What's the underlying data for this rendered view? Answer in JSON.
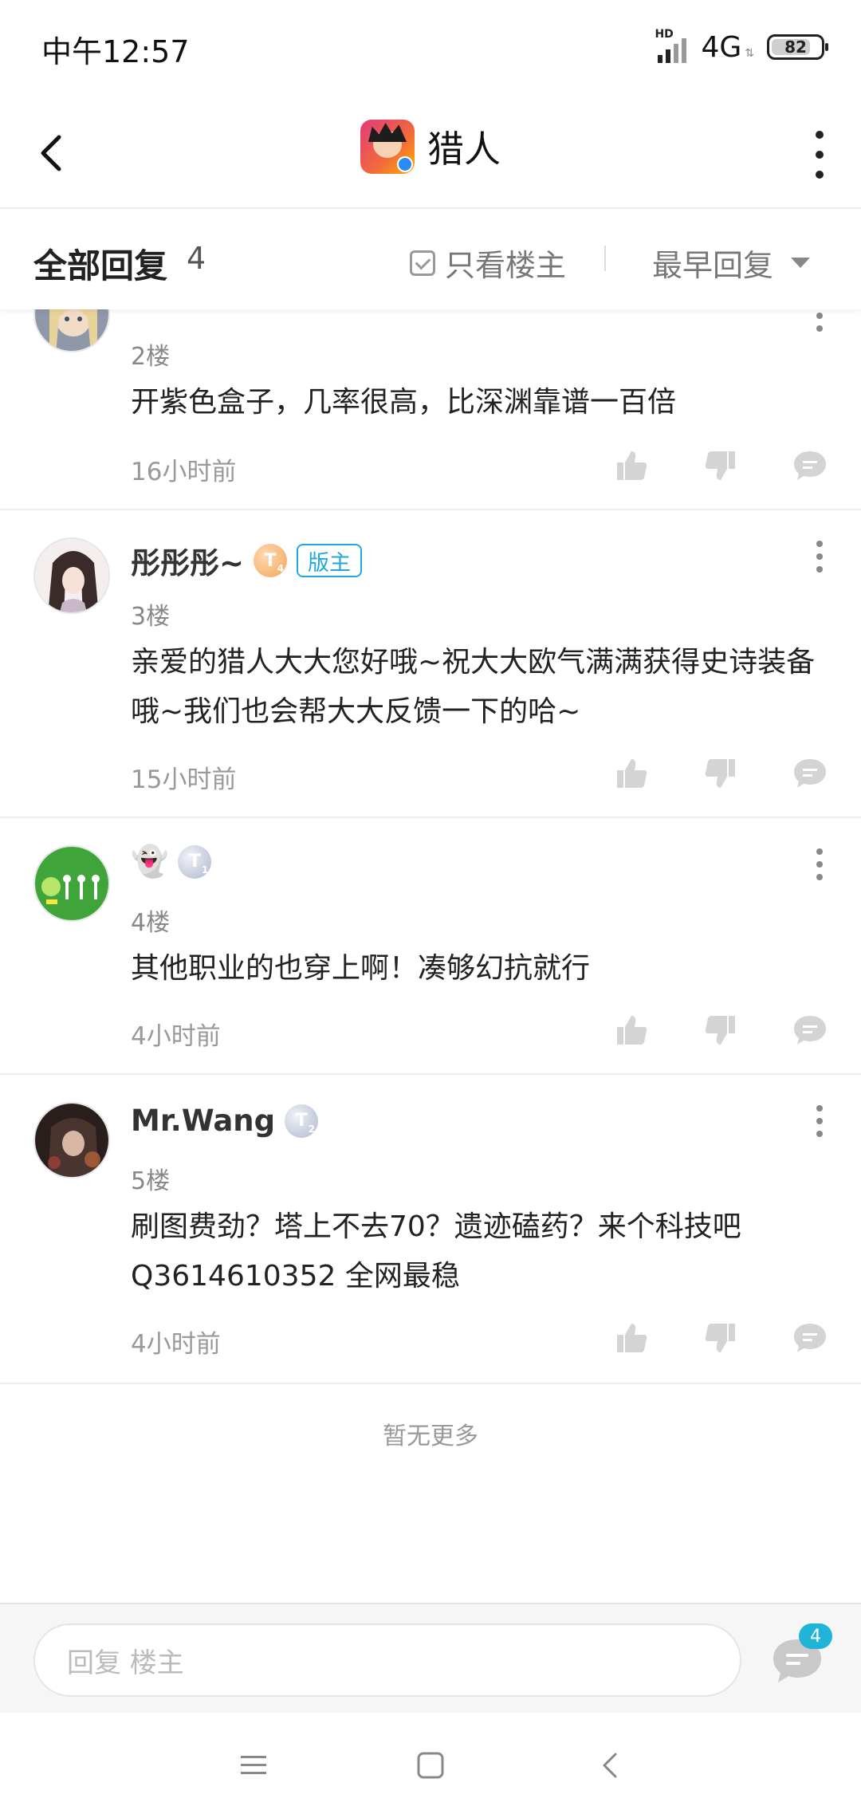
{
  "status": {
    "time": "中午12:57",
    "signal_label": "HD",
    "network": "4G",
    "battery": "82",
    "battery_level_percent": 82
  },
  "header": {
    "title": "猎人",
    "back_icon": "chevron-left-icon",
    "more_icon": "more-vertical-icon"
  },
  "filter": {
    "title": "全部回复",
    "count": "4",
    "only_op_label": "只看楼主",
    "sort_label": "最早回复"
  },
  "comments": [
    {
      "floor": "2楼",
      "text": "开紫色盒子，几率很高，比深渊靠谱一百倍",
      "time": "16小时前"
    },
    {
      "name": "彤彤彤~",
      "level": "T",
      "level_num": "4",
      "tag": "版主",
      "floor": "3楼",
      "text": "亲爱的猎人大大您好哦~祝大大欧气满满获得史诗装备哦~我们也会帮大大反馈一下的哈~",
      "time": "15小时前"
    },
    {
      "name": "👻",
      "level": "T",
      "level_num": "1",
      "floor": "4楼",
      "text": "其他职业的也穿上啊！凑够幻抗就行",
      "time": "4小时前"
    },
    {
      "name": "Mr.Wang",
      "level": "T",
      "level_num": "2",
      "floor": "5楼",
      "text": "刷图费劲？塔上不去70？遗迹磕药？来个科技吧Q3614610352  全网最稳",
      "time": "4小时前"
    }
  ],
  "no_more": "暂无更多",
  "reply": {
    "placeholder": "回复  楼主",
    "badge": "4"
  },
  "colors": {
    "accent": "#20a8d8",
    "text": "#222222",
    "muted": "#999999"
  }
}
